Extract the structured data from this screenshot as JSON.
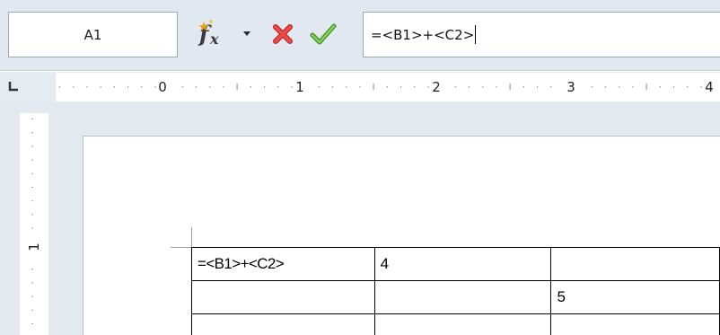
{
  "formula_bar": {
    "name_box": "A1",
    "input_text": "=<B1>+<C2>",
    "icons": {
      "function": "fx-icon",
      "dropdown": "chevron-down-icon",
      "cancel": "close-icon",
      "accept": "checkmark-icon"
    },
    "colors": {
      "cancel": "#e23b3b",
      "accept": "#5bb236",
      "fx": "#e3a11a",
      "toolbar_bg": "#e1e8f0"
    }
  },
  "ruler": {
    "corner_icon": "tab-stop-icon",
    "h_labels": [
      "0",
      "1",
      "2",
      "3",
      "4"
    ],
    "v_labels": [
      "1"
    ]
  },
  "table": {
    "rows": [
      [
        "=<B1>+<C2>",
        "4",
        ""
      ],
      [
        "",
        "",
        "5"
      ],
      [
        "",
        "",
        ""
      ]
    ]
  }
}
